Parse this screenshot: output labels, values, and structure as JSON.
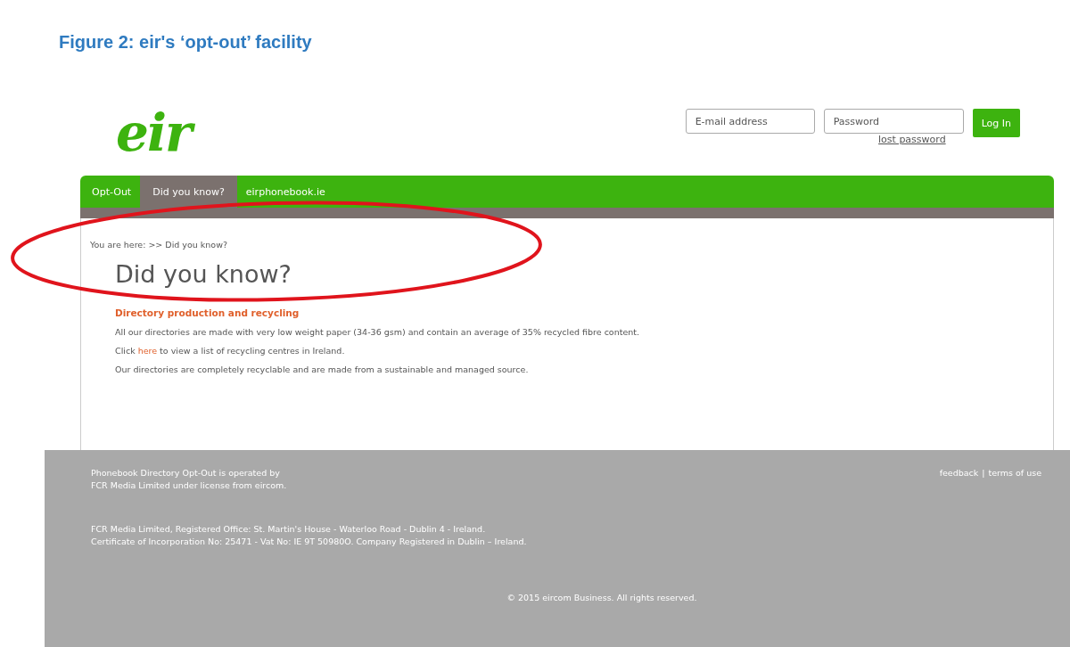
{
  "caption": "Figure 2: eir's ‘opt-out’ facility",
  "header": {
    "logo": "eir",
    "email": {
      "placeholder": "E-mail address"
    },
    "password": {
      "placeholder": "Password"
    },
    "login_button": "Log In",
    "lost_password": "lost password"
  },
  "tabs": [
    {
      "label": "Opt-Out",
      "selected": false
    },
    {
      "label": "Did you know?",
      "selected": true
    },
    {
      "label": "eirphonebook.ie",
      "selected": false
    }
  ],
  "breadcrumb": "You are here: >> Did you know?",
  "heading": "Did you know?",
  "subheading": "Directory production and recycling",
  "paragraphs": [
    {
      "before": "All our directories are made with very low weight paper (34-36 gsm) and contain an average of 35% recycled fibre content."
    },
    {
      "before": "Click",
      "link": "here",
      "after": "to view a list of recycling centres in Ireland."
    },
    {
      "before": "Our directories are completely recyclable and are made from a sustainable and managed source."
    }
  ],
  "footer": {
    "operated": [
      "Phonebook Directory Opt-Out is operated by",
      "FCR Media Limited under license from eircom."
    ],
    "links": [
      "feedback",
      "terms of use"
    ],
    "separator": "|",
    "registered": [
      "FCR Media Limited, Registered Office: St. Martin's House - Waterloo Road - Dublin 4 - Ireland.",
      "Certificate of Incorporation No: 25471 - Vat No: IE 9T 50980O. Company Registered in Dublin – Ireland."
    ],
    "copyright": "© 2015 eircom Business. All rights reserved."
  },
  "annotation": {
    "kind": "ellipse",
    "color": "#e0141c"
  }
}
